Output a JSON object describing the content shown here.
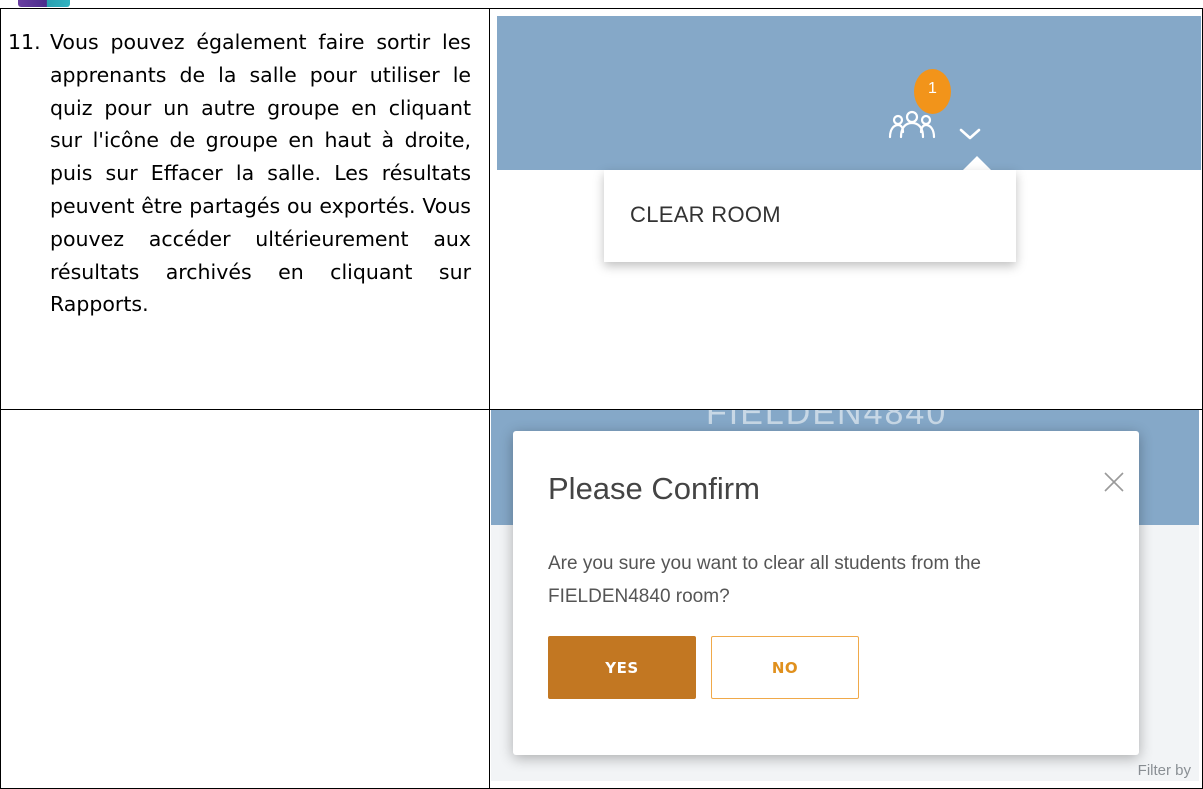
{
  "colors": {
    "header_blue": "#85a8c8",
    "badge_orange": "#f2941a",
    "yes_button": "#c27722",
    "no_button_border": "#f0a94a"
  },
  "instruction": {
    "number": "11.",
    "text": "Vous pouvez également faire sortir les apprenants de la salle pour utiliser le quiz pour un autre groupe en cliquant sur l'icône de groupe en haut à droite, puis sur Effacer la salle. Les résultats peuvent être partagés ou exportés. Vous pouvez accéder ultérieurement aux résultats archivés en cliquant sur Rapports."
  },
  "screenshot1": {
    "badge_count": "1",
    "group_icon": "group-icon",
    "chevron_icon": "chevron-down-icon",
    "menu_item": "CLEAR ROOM"
  },
  "screenshot2": {
    "background_room": "FIELDEN4840",
    "background_filter": "Filter by",
    "dialog": {
      "title": "Please Confirm",
      "close_icon": "close-icon",
      "message": "Are you sure you want to clear all students from the FIELDEN4840 room?",
      "yes_label": "YES",
      "no_label": "NO"
    }
  }
}
